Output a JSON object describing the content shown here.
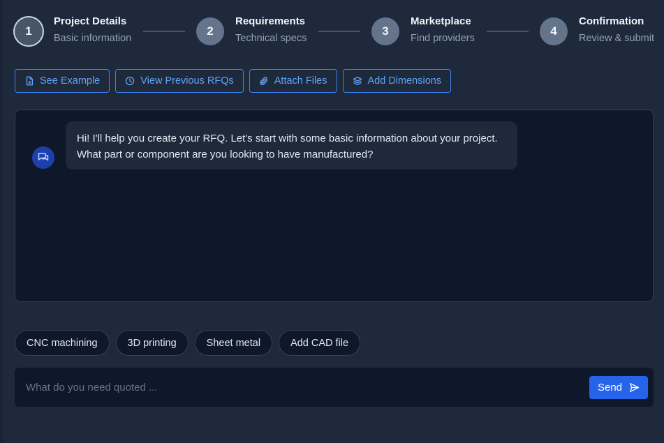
{
  "stepper": {
    "steps": [
      {
        "number": "1",
        "title": "Project Details",
        "subtitle": "Basic information",
        "active": true
      },
      {
        "number": "2",
        "title": "Requirements",
        "subtitle": "Technical specs",
        "active": false
      },
      {
        "number": "3",
        "title": "Marketplace",
        "subtitle": "Find providers",
        "active": false
      },
      {
        "number": "4",
        "title": "Confirmation",
        "subtitle": "Review & submit",
        "active": false
      }
    ]
  },
  "toolbar": {
    "see_example": "See Example",
    "view_previous": "View Previous RFQs",
    "attach_files": "Attach Files",
    "add_dimensions": "Add Dimensions"
  },
  "chat": {
    "messages": [
      {
        "sender": "assistant",
        "text": "Hi! I'll help you create your RFQ. Let's start with some basic information about your project. What part or component are you looking to have manufactured?"
      }
    ]
  },
  "suggestions": [
    "CNC machining",
    "3D printing",
    "Sheet metal",
    "Add CAD file"
  ],
  "composer": {
    "placeholder": "What do you need quoted ...",
    "value": "",
    "send_label": "Send"
  },
  "colors": {
    "background": "#1e293b",
    "panel": "#0f172a",
    "accent": "#3b82f6",
    "send_button": "#2563eb"
  },
  "icons": {
    "see_example": "file-icon",
    "view_previous": "clock-icon",
    "attach_files": "paperclip-icon",
    "add_dimensions": "layers-icon",
    "bot": "chat-bubble-icon",
    "send": "send-icon"
  }
}
